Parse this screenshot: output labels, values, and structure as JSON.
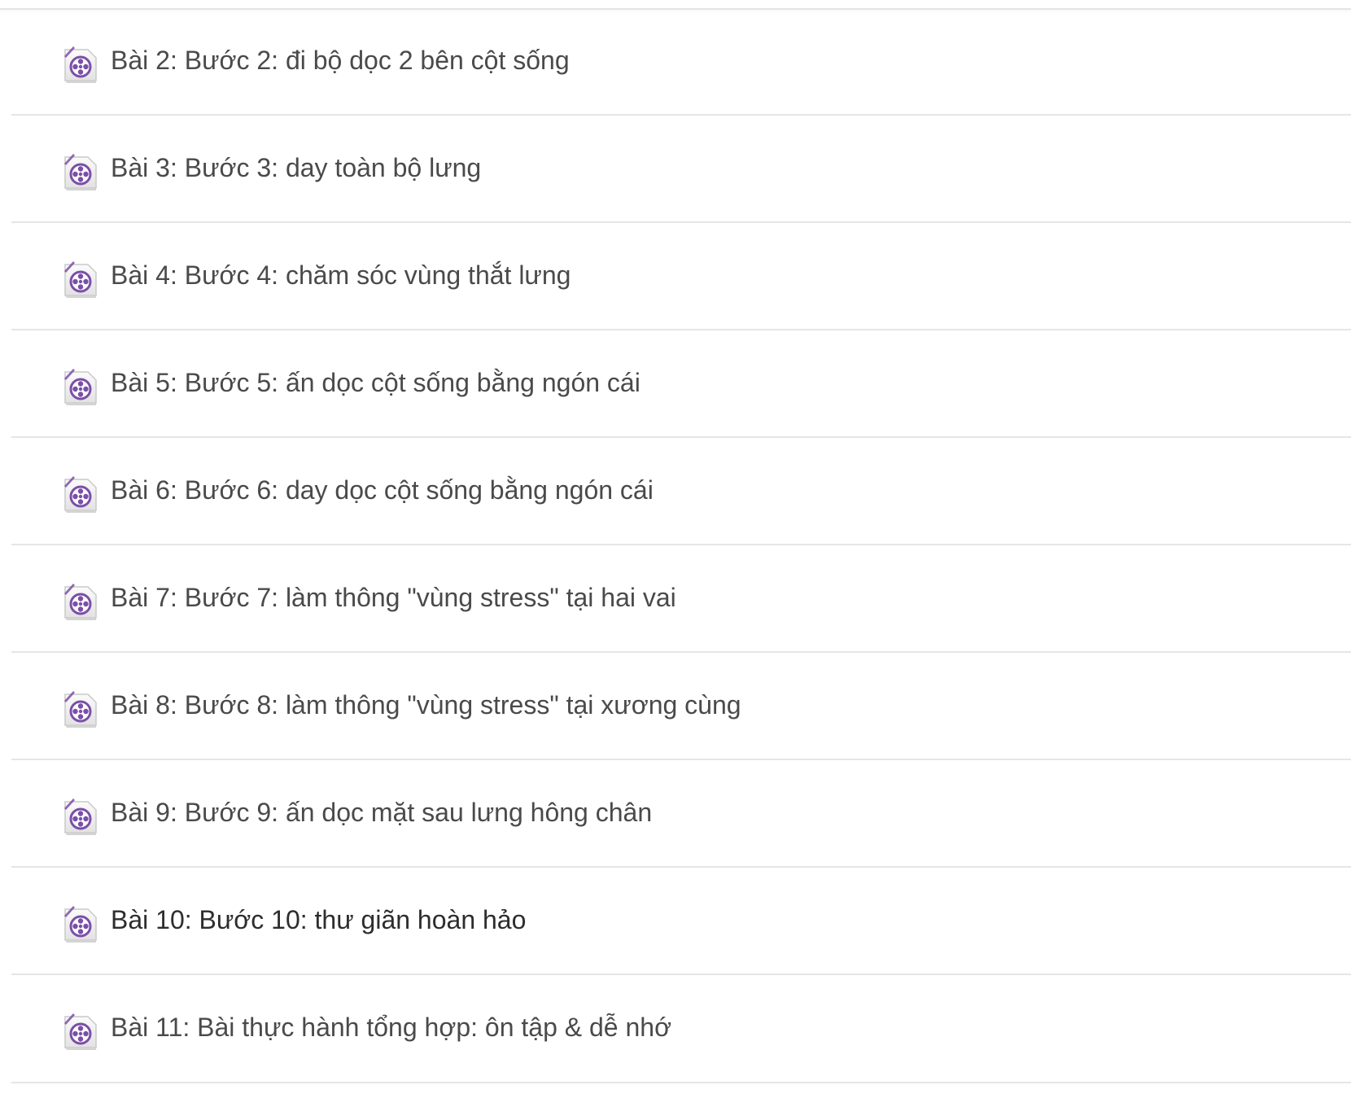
{
  "lessons": [
    {
      "title": "Bài 2: Bước 2: đi bộ dọc 2 bên cột sống",
      "icon": "video-file-icon"
    },
    {
      "title": "Bài 3: Bước 3: day toàn bộ lưng",
      "icon": "video-file-icon"
    },
    {
      "title": "Bài 4: Bước 4: chăm sóc vùng thắt lưng",
      "icon": "video-file-icon"
    },
    {
      "title": "Bài 5: Bước 5: ấn dọc cột sống bằng ngón cái",
      "icon": "video-file-icon"
    },
    {
      "title": "Bài 6: Bước 6: day dọc cột sống bằng ngón cái",
      "icon": "video-file-icon"
    },
    {
      "title": "Bài 7: Bước 7: làm thông \"vùng stress\" tại hai vai",
      "icon": "video-file-icon"
    },
    {
      "title": "Bài 8: Bước 8: làm thông \"vùng stress\" tại xương cùng",
      "icon": "video-file-icon"
    },
    {
      "title": "Bài 9: Bước 9: ấn dọc mặt sau lưng hông chân",
      "icon": "video-file-icon"
    },
    {
      "title": "Bài 10: Bước 10: thư giãn hoàn hảo",
      "icon": "video-file-icon"
    },
    {
      "title": "Bài 11: Bài thực hành tổng hợp: ôn tập & dễ nhớ",
      "icon": "video-file-icon"
    }
  ],
  "colors": {
    "icon_accent": "#7b4fa8",
    "text": "#4a4a4a",
    "divider": "#e6e6e6"
  }
}
